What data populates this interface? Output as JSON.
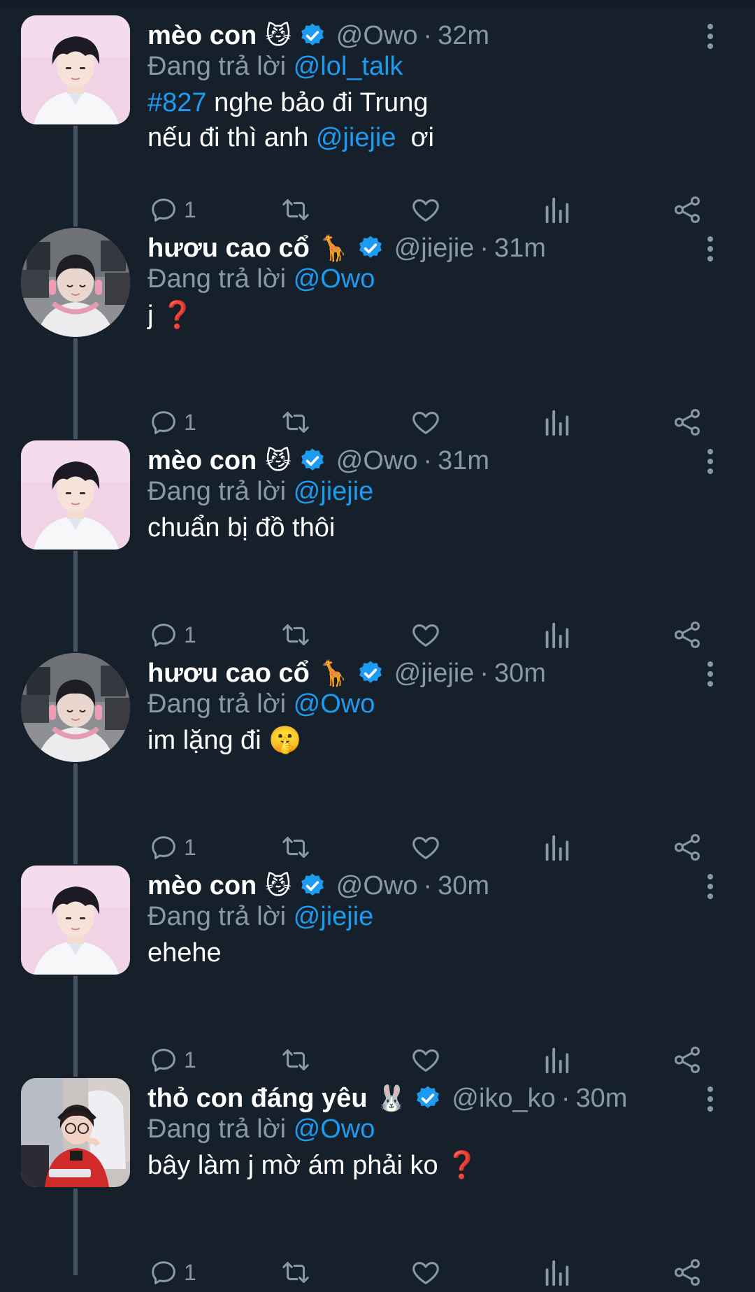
{
  "tweets": [
    {
      "name": "mèo con",
      "emoji": "😼",
      "handle": "@Owo",
      "time": "32m",
      "replying_prefix": "Đang trả lời",
      "replying_to": "@lol_talk",
      "lines": [
        [
          {
            "t": "#827",
            "link": true
          },
          {
            "t": " nghe bảo đi Trung",
            "link": false
          }
        ],
        [
          {
            "t": "nếu đi thì anh ",
            "link": false
          },
          {
            "t": "@jiejie",
            "link": true
          },
          {
            "t": "  ơi",
            "link": false
          }
        ]
      ],
      "reply_count": "1",
      "avatar": "meo"
    },
    {
      "name": "hươu cao cổ",
      "emoji": "🦒",
      "handle": "@jiejie",
      "time": "31m",
      "replying_prefix": "Đang trả lời",
      "replying_to": "@Owo",
      "lines": [
        [
          {
            "t": "j ",
            "link": false
          },
          {
            "t": "❓",
            "link": false,
            "emoji": true
          }
        ]
      ],
      "reply_count": "1",
      "avatar": "huou"
    },
    {
      "name": "mèo con",
      "emoji": "😼",
      "handle": "@Owo",
      "time": "31m",
      "replying_prefix": "Đang trả lời",
      "replying_to": "@jiejie",
      "lines": [
        [
          {
            "t": "chuẩn bị đồ thôi",
            "link": false
          }
        ]
      ],
      "reply_count": "1",
      "avatar": "meo"
    },
    {
      "name": "hươu cao cổ",
      "emoji": "🦒",
      "handle": "@jiejie",
      "time": "30m",
      "replying_prefix": "Đang trả lời",
      "replying_to": "@Owo",
      "lines": [
        [
          {
            "t": "im lặng đi ",
            "link": false
          },
          {
            "t": "🤫",
            "link": false,
            "emoji": true
          }
        ]
      ],
      "reply_count": "1",
      "avatar": "huou"
    },
    {
      "name": "mèo con",
      "emoji": "😼",
      "handle": "@Owo",
      "time": "30m",
      "replying_prefix": "Đang trả lời",
      "replying_to": "@jiejie",
      "lines": [
        [
          {
            "t": "ehehe",
            "link": false
          }
        ]
      ],
      "reply_count": "1",
      "avatar": "meo"
    },
    {
      "name": "thỏ con đáng yêu",
      "emoji": "🐰",
      "handle": "@iko_ko",
      "time": "30m",
      "replying_prefix": "Đang trả lời",
      "replying_to": "@Owo",
      "lines": [
        [
          {
            "t": "bây làm j mờ ám phải ko ",
            "link": false
          },
          {
            "t": "❓",
            "link": false,
            "emoji": true
          }
        ]
      ],
      "reply_count": "1",
      "avatar": "tho"
    }
  ],
  "icons": {
    "reply": "reply-icon",
    "retweet": "retweet-icon",
    "like": "heart-icon",
    "views": "analytics-icon",
    "share": "share-icon",
    "more": "more-options-icon",
    "verified": "verified-badge-icon"
  },
  "colors": {
    "background": "#15202b",
    "link": "#1d9bf0",
    "muted": "#8899a6",
    "thread_line": "#425463"
  }
}
